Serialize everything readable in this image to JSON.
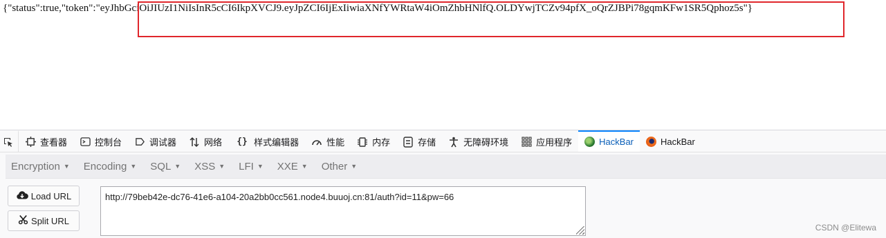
{
  "response": {
    "prefix": "{\"status\":true,\"token\":\"",
    "token": "eyJhbGciOiJIUzI1NiIsInR5cCI6IkpXVCJ9.eyJpZCI6IjExIiwiaXNfYWRtaW4iOmZhbHNlfQ.OLDYwjTCZv94pfX_oQrZJBPi78gqmKFw1SR5Qphoz5s",
    "suffix": "\"}"
  },
  "devtools_tabs": [
    {
      "label": "查看器",
      "icon": "inspector-icon"
    },
    {
      "label": "控制台",
      "icon": "console-icon"
    },
    {
      "label": "调试器",
      "icon": "debugger-icon"
    },
    {
      "label": "网络",
      "icon": "network-icon"
    },
    {
      "label": "样式编辑器",
      "icon": "style-editor-icon"
    },
    {
      "label": "性能",
      "icon": "performance-icon"
    },
    {
      "label": "内存",
      "icon": "memory-icon"
    },
    {
      "label": "存储",
      "icon": "storage-icon"
    },
    {
      "label": "无障碍环境",
      "icon": "accessibility-icon"
    },
    {
      "label": "应用程序",
      "icon": "application-icon"
    },
    {
      "label": "HackBar",
      "icon": "hackbar-green-icon"
    },
    {
      "label": "HackBar",
      "icon": "hackbar-orange-icon"
    }
  ],
  "hackbar_menu": [
    "Encryption",
    "Encoding",
    "SQL",
    "XSS",
    "LFI",
    "XXE",
    "Other"
  ],
  "buttons": {
    "load_url": "Load URL",
    "split_url": "Split URL"
  },
  "url_field": {
    "value": "http://79beb42e-dc76-41e6-a104-20a2bb0cc561.node4.buuoj.cn:81/auth?id=11&pw=66"
  },
  "watermark": "CSDN @Elitewa",
  "colors": {
    "highlight_border": "#e0262b",
    "active_tab_accent": "#0a84ff"
  }
}
